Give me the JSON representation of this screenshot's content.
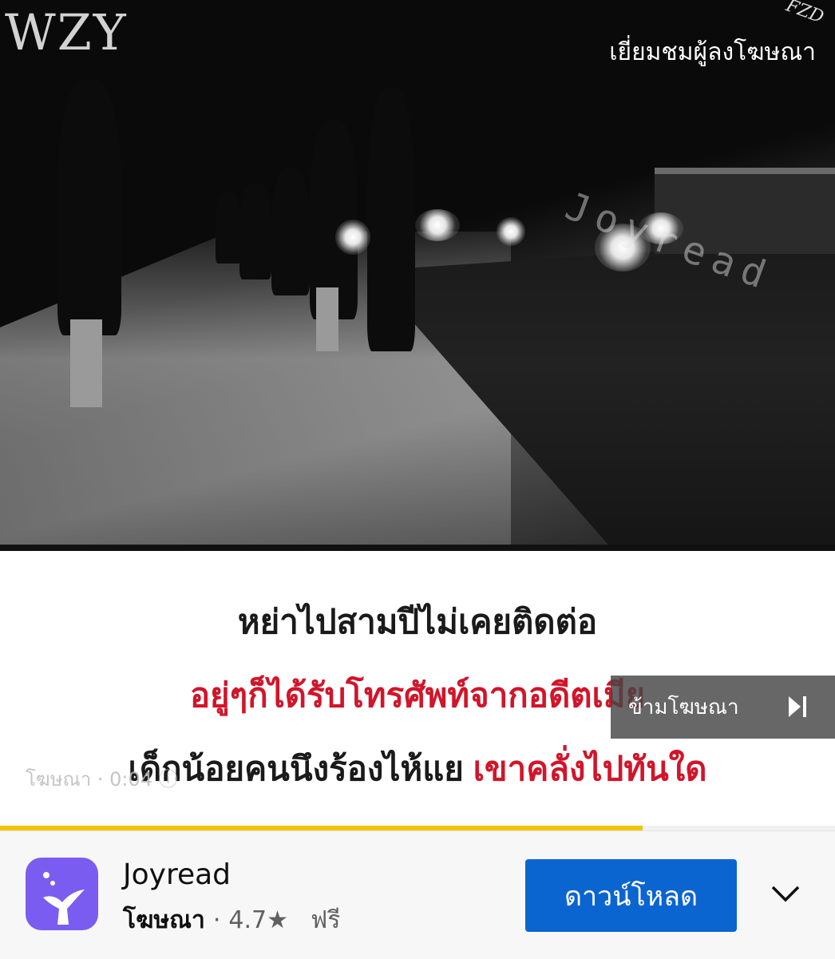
{
  "video": {
    "watermark_left": "WZY",
    "watermark_right": "FZD",
    "watermark_mid": "Joyread",
    "visit_advertiser": "เยี่ยมชมผู้ลงโฆษณา",
    "captions": {
      "line1": "หย่าไปสามปีไม่เคยติดต่อ",
      "line2": "อยู่ๆก็ได้รับโทรศัพท์จากอดีตเมีย",
      "line3_black": "เด็กน้อยคนนึงร้องไห้แย",
      "line3_red": "เขาคลั่งไปทันใด"
    },
    "ad_timer": "โฆษณา · 0:04 ⓘ",
    "skip_label": "ข้ามโฆษณา",
    "progress": 0.77
  },
  "app": {
    "name": "Joyread",
    "ad_label": "โฆษณา",
    "separator": "·",
    "rating": "4.7★",
    "price": "ฟรี",
    "download_label": "ดาวน์โหลด",
    "icon": "joyread-whale-tail-icon",
    "brand_color": "#7b5cf0",
    "button_color": "#0b65d0"
  }
}
